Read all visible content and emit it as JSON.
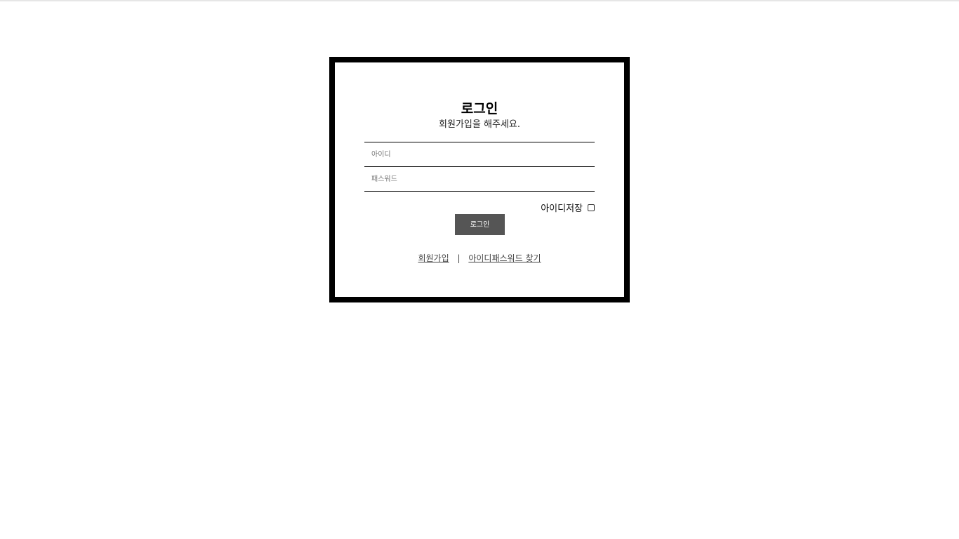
{
  "login": {
    "title": "로그인",
    "subtitle": "회원가입을 해주세요.",
    "id_placeholder": "아이디",
    "password_placeholder": "패스워드",
    "save_id_label": "아이디저장",
    "save_id_checked": false,
    "submit_label": "로그인",
    "links": {
      "signup": "회원가입",
      "separator": "|",
      "find_account": "아이디패스워드 찾기"
    },
    "colors": {
      "border": "#000000",
      "button_bg": "#555555",
      "button_text": "#ffffff"
    }
  }
}
